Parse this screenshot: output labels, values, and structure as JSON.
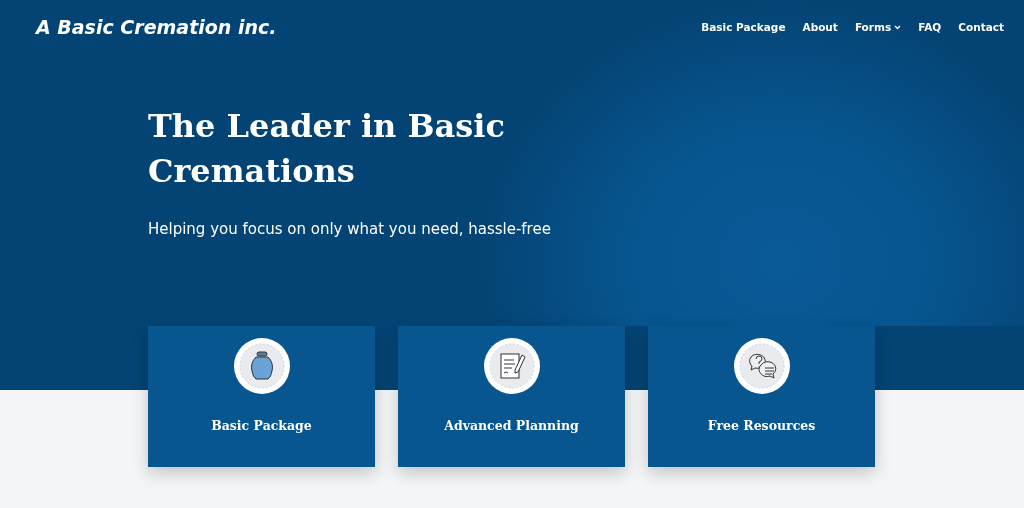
{
  "header": {
    "logo": "A Basic Cremation inc.",
    "nav": [
      {
        "label": "Basic Package",
        "dropdown": false
      },
      {
        "label": "About",
        "dropdown": false
      },
      {
        "label": "Forms",
        "dropdown": true
      },
      {
        "label": "FAQ",
        "dropdown": false
      },
      {
        "label": "Contact",
        "dropdown": false
      }
    ]
  },
  "hero": {
    "title": "The Leader in Basic Cremations",
    "subtitle": "Helping you focus on only what you need, hassle-free"
  },
  "cards": [
    {
      "kind": "urn",
      "label": "Basic Package"
    },
    {
      "kind": "document",
      "label": "Advanced Planning"
    },
    {
      "kind": "chat",
      "label": "Free Resources"
    }
  ]
}
